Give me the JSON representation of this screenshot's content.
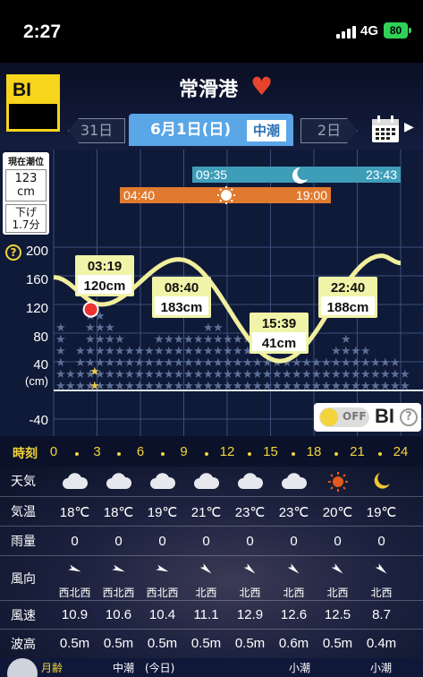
{
  "status_bar": {
    "time": "2:27",
    "network": "4G",
    "battery": "80"
  },
  "header": {
    "logo": "BI",
    "port_name": "常滑港",
    "prev_day": "31日",
    "current_date": "6月1日(日)",
    "tide_type": "中潮",
    "next_day": "2日"
  },
  "chart": {
    "current_panel": {
      "title": "現在潮位",
      "value": "123\ncm",
      "trend": "下げ\n1.7分"
    },
    "help": "?",
    "moon_bar": {
      "rise": "09:35",
      "set": "23:43"
    },
    "sun_bar": {
      "rise": "04:40",
      "set": "19:00"
    },
    "y_ticks": [
      "200",
      "160",
      "120",
      "80",
      "40",
      "(cm)",
      "-40"
    ],
    "toggle": {
      "state": "OFF",
      "label": "BI",
      "help": "?"
    }
  },
  "chart_data": {
    "type": "line",
    "x": [
      0,
      3.3167,
      8.6667,
      15.65,
      22.6667,
      24
    ],
    "xlabel": "時刻",
    "x_range": [
      0,
      24
    ],
    "y_range": [
      -40,
      200
    ],
    "ylabel": "(cm)",
    "extrema": [
      {
        "time": "03:19",
        "value": "120cm",
        "hour": 3.3167,
        "cm": 120
      },
      {
        "time": "08:40",
        "value": "183cm",
        "hour": 8.6667,
        "cm": 183
      },
      {
        "time": "15:39",
        "value": "41cm",
        "hour": 15.65,
        "cm": 41
      },
      {
        "time": "22:40",
        "value": "188cm",
        "hour": 22.6667,
        "cm": 188
      }
    ],
    "current": {
      "hour": 2.45,
      "cm": 123
    }
  },
  "time_axis": {
    "label": "時刻",
    "hours": [
      "0",
      "3",
      "6",
      "9",
      "12",
      "15",
      "18",
      "21",
      "24"
    ]
  },
  "weather": {
    "rows": [
      {
        "label": "天気",
        "icons": [
          "cloud-icon",
          "cloud-icon",
          "cloud-icon",
          "cloud-icon",
          "cloud-icon",
          "cloud-icon",
          "sun-icon",
          "moon-icon"
        ]
      },
      {
        "label": "気温",
        "values": [
          "18℃",
          "18℃",
          "19℃",
          "21℃",
          "23℃",
          "23℃",
          "20℃",
          "19℃"
        ]
      },
      {
        "label": "雨量",
        "values": [
          "0",
          "0",
          "0",
          "0",
          "0",
          "0",
          "0",
          "0"
        ]
      },
      {
        "label": "風向",
        "values": [
          "西北西",
          "西北西",
          "西北西",
          "北西",
          "北西",
          "北西",
          "北西",
          "北西"
        ]
      },
      {
        "label": "風速",
        "values": [
          "10.9",
          "10.6",
          "10.4",
          "11.1",
          "12.9",
          "12.6",
          "12.5",
          "8.7"
        ]
      },
      {
        "label": "波高",
        "values": [
          "0.5m",
          "0.5m",
          "0.5m",
          "0.5m",
          "0.5m",
          "0.6m",
          "0.5m",
          "0.4m"
        ]
      }
    ]
  },
  "bottom_strip": {
    "moon_age": "月齢",
    "tide_today": "中潮　(今日)",
    "tide_next1": "小潮",
    "tide_next2": "小潮"
  },
  "colors": {
    "accent_yellow": "#f3d43a",
    "moon_bar": "#3e9eb8",
    "sun_bar": "#e07a2e",
    "date_tab": "#5aa6e6",
    "heart": "#e8432d"
  }
}
